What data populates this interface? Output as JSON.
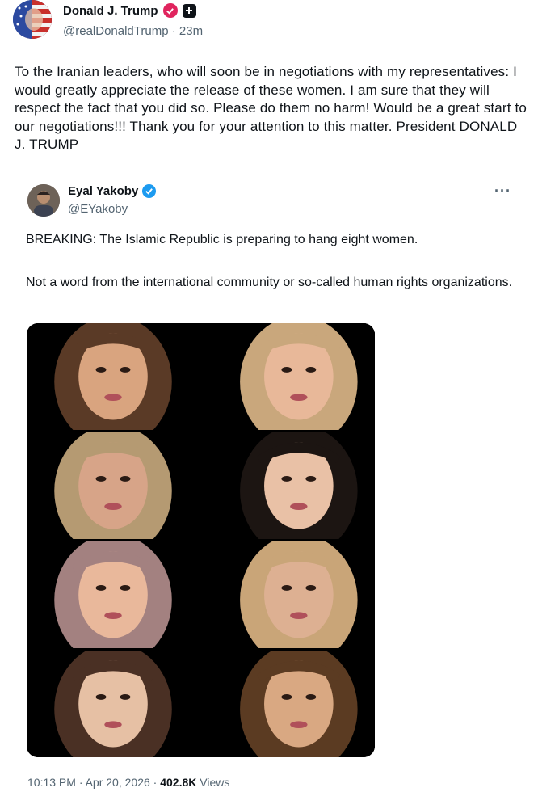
{
  "outer_post": {
    "display_name": "Donald J. Trump",
    "handle_time": "@realDonaldTrump · 23m",
    "text": "To the Iranian leaders, who will soon be in negotiations with my representatives: I would greatly appreciate the release of these women. I am sure that they will respect the fact that you did so. Please do them no harm! Would be a great start to our negotiations!!! Thank you for your attention to this matter. President DONALD J. TRUMP",
    "verified_color": "#e0245e"
  },
  "quoted_post": {
    "display_name": "Eyal Yakoby",
    "handle": "@EYakoby",
    "more_label": "···",
    "line1": "BREAKING: The Islamic Republic is preparing to hang eight women.",
    "line2": "Not a word from the international community or so-called human rights organizations.",
    "verified_color": "#1d9bf0",
    "time_date": "10:13 PM · Apr 20, 2026 · ",
    "views_count": "402.8K",
    "views_label": " Views"
  },
  "photos": [
    {
      "hair": "#5a3a26",
      "skin": "#d9a47f",
      "bg": "#000000"
    },
    {
      "hair": "#c9a77c",
      "skin": "#e8b899",
      "bg": "#000000"
    },
    {
      "hair": "#b59a72",
      "skin": "#d7a488",
      "bg": "#000000"
    },
    {
      "hair": "#1c1512",
      "skin": "#e9c1a6",
      "bg": "#000000"
    },
    {
      "hair": "#a38180",
      "skin": "#e9b89b",
      "bg": "#000000"
    },
    {
      "hair": "#c9a578",
      "skin": "#ddb092",
      "bg": "#000000"
    },
    {
      "hair": "#4a3024",
      "skin": "#e6c0a4",
      "bg": "#000000"
    },
    {
      "hair": "#5b3b22",
      "skin": "#d9a882",
      "bg": "#000000"
    }
  ]
}
